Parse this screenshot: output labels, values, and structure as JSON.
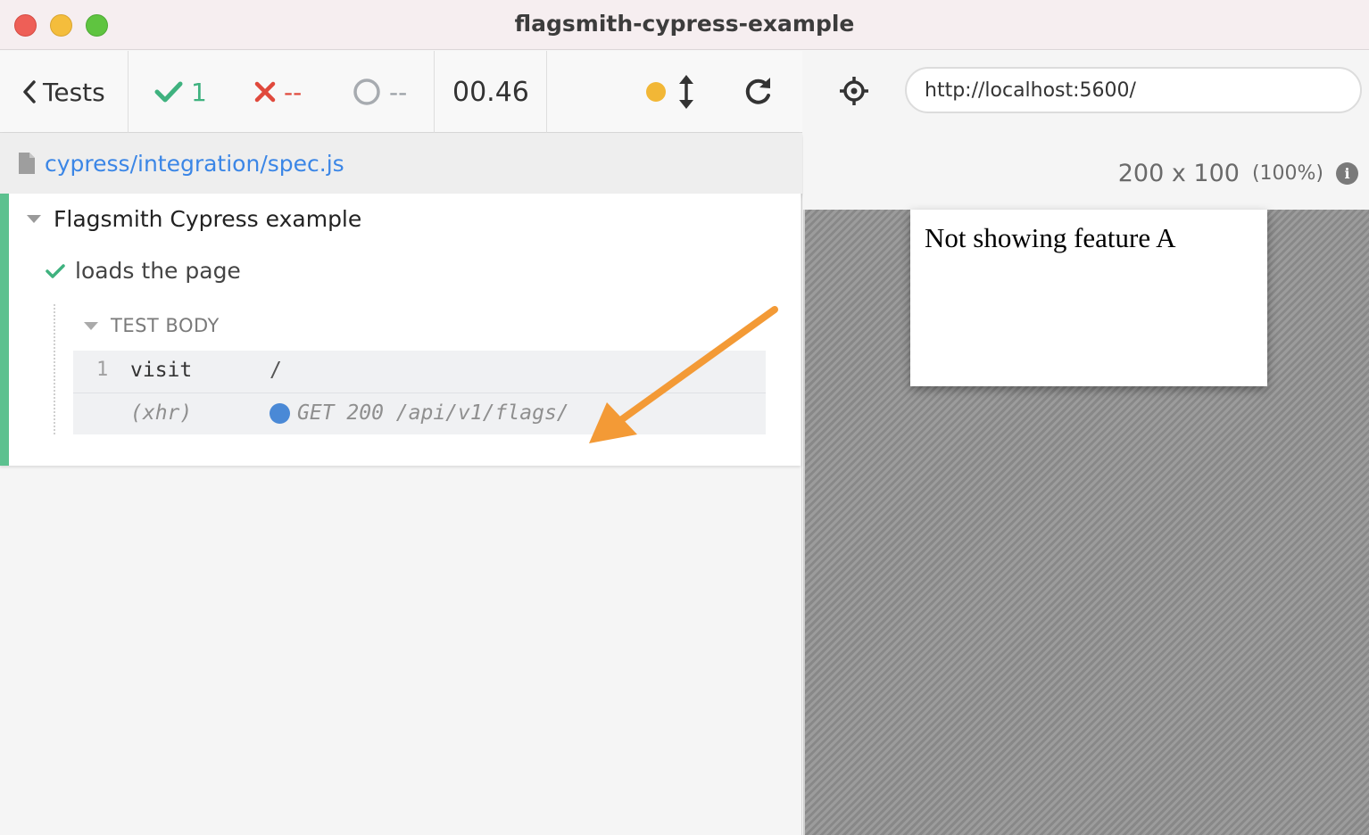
{
  "window": {
    "title": "flagsmith-cypress-example"
  },
  "toolbar": {
    "tests_label": "Tests",
    "passed": "1",
    "failed": "--",
    "pending": "--",
    "duration": "00.46"
  },
  "spec": {
    "path": "cypress/integration/spec.js"
  },
  "suite": {
    "title": "Flagsmith Cypress example",
    "test": {
      "title": "loads the page",
      "body_title": "TEST BODY",
      "commands": [
        {
          "num": "1",
          "name": "visit",
          "message": "/"
        },
        {
          "num": "",
          "name": "(xhr)",
          "message": "GET 200 /api/v1/flags/"
        }
      ]
    }
  },
  "aut": {
    "url": "http://localhost:5600/",
    "viewport_size": "200 x 100",
    "viewport_scale": "(100%)",
    "page_text": "Not showing feature A"
  },
  "colors": {
    "pass": "#3fb27f",
    "fail": "#e0493c",
    "link": "#3b86e6",
    "annotation_arrow": "#f39a36",
    "running_dot": "#f2b736"
  }
}
